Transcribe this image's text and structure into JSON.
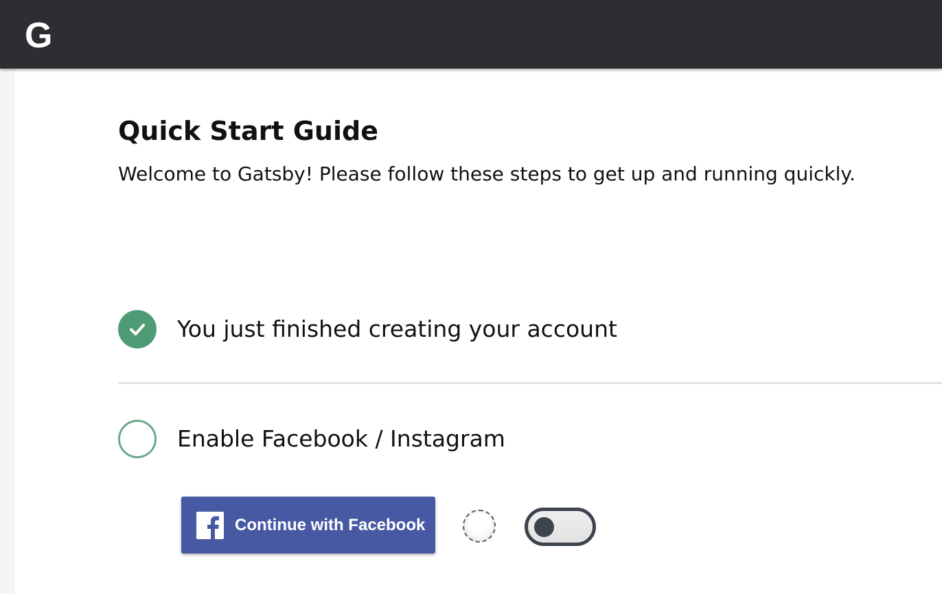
{
  "header": {
    "logo_text": "G",
    "background_color": "#2d2e32"
  },
  "guide": {
    "title": "Quick Start Guide",
    "subtitle": "Welcome to Gatsby! Please follow these steps to get up and running quickly."
  },
  "steps": [
    {
      "label": "You just finished creating your account",
      "status": "completed",
      "icon": "check-circle-icon",
      "color": "#4f9b76"
    },
    {
      "label": "Enable Facebook / Instagram",
      "status": "pending",
      "icon": "empty-circle-icon",
      "color": "#6aaa8a"
    }
  ],
  "facebook": {
    "button_label": "Continue with Facebook",
    "icon": "facebook-icon",
    "color": "#4859a4"
  },
  "toggle": {
    "state": "off",
    "color": "#3d444d"
  }
}
